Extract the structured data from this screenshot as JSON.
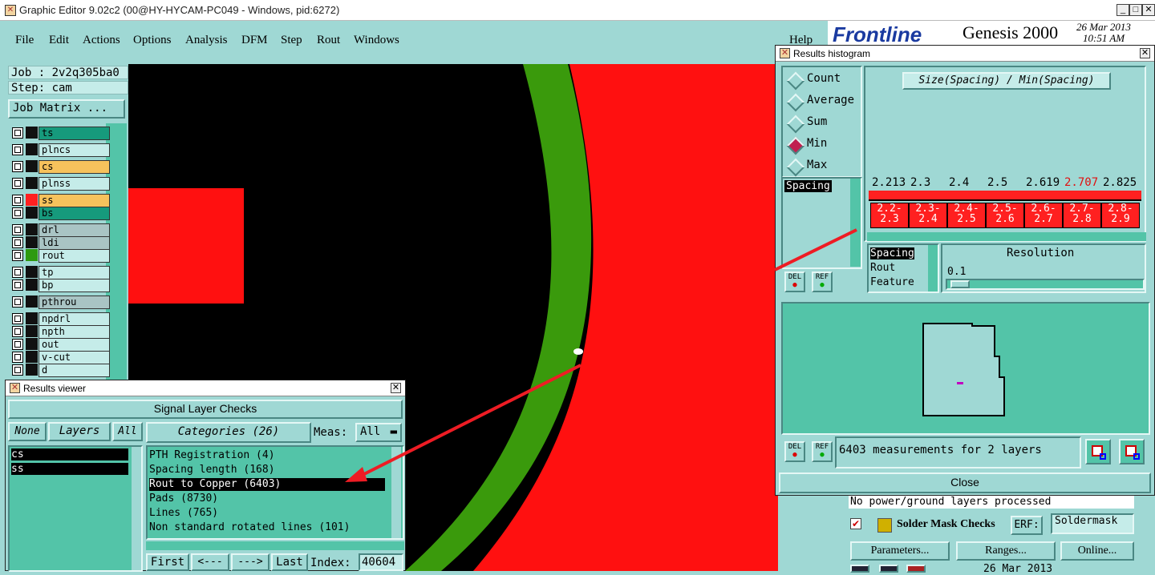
{
  "window": {
    "title": "Graphic Editor 9.02c2 (00@HY-HYCAM-PC049 - Windows, pid:6272)"
  },
  "menu": [
    "File",
    "Edit",
    "Actions",
    "Options",
    "Analysis",
    "DFM",
    "Step",
    "Rout",
    "Windows"
  ],
  "help_label": "Help",
  "brand": {
    "logo": "Frontline",
    "product": "Genesis 2000",
    "date": "26 Mar 2013",
    "time": "10:51 AM"
  },
  "job": {
    "job_label": "Job : 2v2q305ba0",
    "step_label": "Step: cam",
    "matrix_button": "Job Matrix ..."
  },
  "layers": [
    {
      "name": "ts",
      "style": "teal",
      "swatch": "#111"
    },
    {
      "name": "plncs",
      "style": "light",
      "swatch": "#111"
    },
    {
      "name": "cs",
      "style": "orange",
      "swatch": "#111"
    },
    {
      "name": "plnss",
      "style": "light",
      "swatch": "#111"
    },
    {
      "name": "ss",
      "style": "orange",
      "swatch": "#ff2020"
    },
    {
      "name": "bs",
      "style": "teal",
      "swatch": "#111"
    },
    {
      "name": "drl",
      "style": "grey",
      "swatch": "#111"
    },
    {
      "name": "ldi",
      "style": "grey",
      "swatch": "#111"
    },
    {
      "name": "rout",
      "style": "light",
      "swatch": "#2e9a10"
    },
    {
      "name": "tp",
      "style": "light",
      "swatch": "#111"
    },
    {
      "name": "bp",
      "style": "light",
      "swatch": "#111"
    },
    {
      "name": "pthrou",
      "style": "grey",
      "swatch": "#111"
    },
    {
      "name": "npdrl",
      "style": "light",
      "swatch": "#111"
    },
    {
      "name": "npth",
      "style": "light",
      "swatch": "#111"
    },
    {
      "name": "out",
      "style": "light",
      "swatch": "#111"
    },
    {
      "name": "v-cut",
      "style": "light",
      "swatch": "#111"
    },
    {
      "name": "d",
      "style": "light",
      "swatch": "#111"
    }
  ],
  "results_viewer": {
    "title": "Results viewer",
    "heading": "Signal Layer Checks",
    "none_btn": "None",
    "layers_btn": "Layers",
    "all_btn": "All",
    "categories_btn": "Categories (26)",
    "meas_label": "Meas:",
    "meas_value": "All",
    "layer_items": [
      "cs",
      "ss"
    ],
    "categories": [
      "PTH Registration (4)",
      "Spacing length (168)",
      "Rout to Copper (6403)",
      "Pads (8730)",
      "Lines (765)",
      "Non standard rotated lines (101)"
    ],
    "nav": {
      "first": "First",
      "prev": "<---",
      "next": "--->",
      "last": "Last",
      "index_label": "Index:",
      "index_value": "40604"
    }
  },
  "histogram": {
    "title": "Results histogram",
    "modes": [
      "Count",
      "Average",
      "Sum",
      "Min",
      "Max"
    ],
    "selected_mode": "Min",
    "formula": "Size(Spacing) / Min(Spacing)",
    "spacing_item": "Spacing",
    "bin_values": [
      "2.213",
      "2.3",
      "2.4",
      "2.5",
      "2.619",
      "2.707",
      "2.825"
    ],
    "bin_labels": [
      [
        "2.2-",
        "2.3"
      ],
      [
        "2.3-",
        "2.4"
      ],
      [
        "2.4-",
        "2.5"
      ],
      [
        "2.5-",
        "2.6"
      ],
      [
        "2.6-",
        "2.7"
      ],
      [
        "2.7-",
        "2.8"
      ],
      [
        "2.8-",
        "2.9"
      ]
    ],
    "attr_items": [
      "Spacing",
      "Rout",
      "Feature"
    ],
    "resolution_label": "Resolution",
    "resolution_value": "0.1",
    "del_label": "DEL",
    "ref_label": "REF",
    "summary": "6403 measurements for 2 layers",
    "close_label": "Close"
  },
  "right_panel": {
    "status": "No power/ground layers processed",
    "check_name": "Solder Mask Checks",
    "erf_label": "ERF:",
    "erf_value": "Soldermask",
    "parameters_btn": "Parameters...",
    "ranges_btn": "Ranges...",
    "online_btn": "Online...",
    "date": "26 Mar 2013"
  }
}
